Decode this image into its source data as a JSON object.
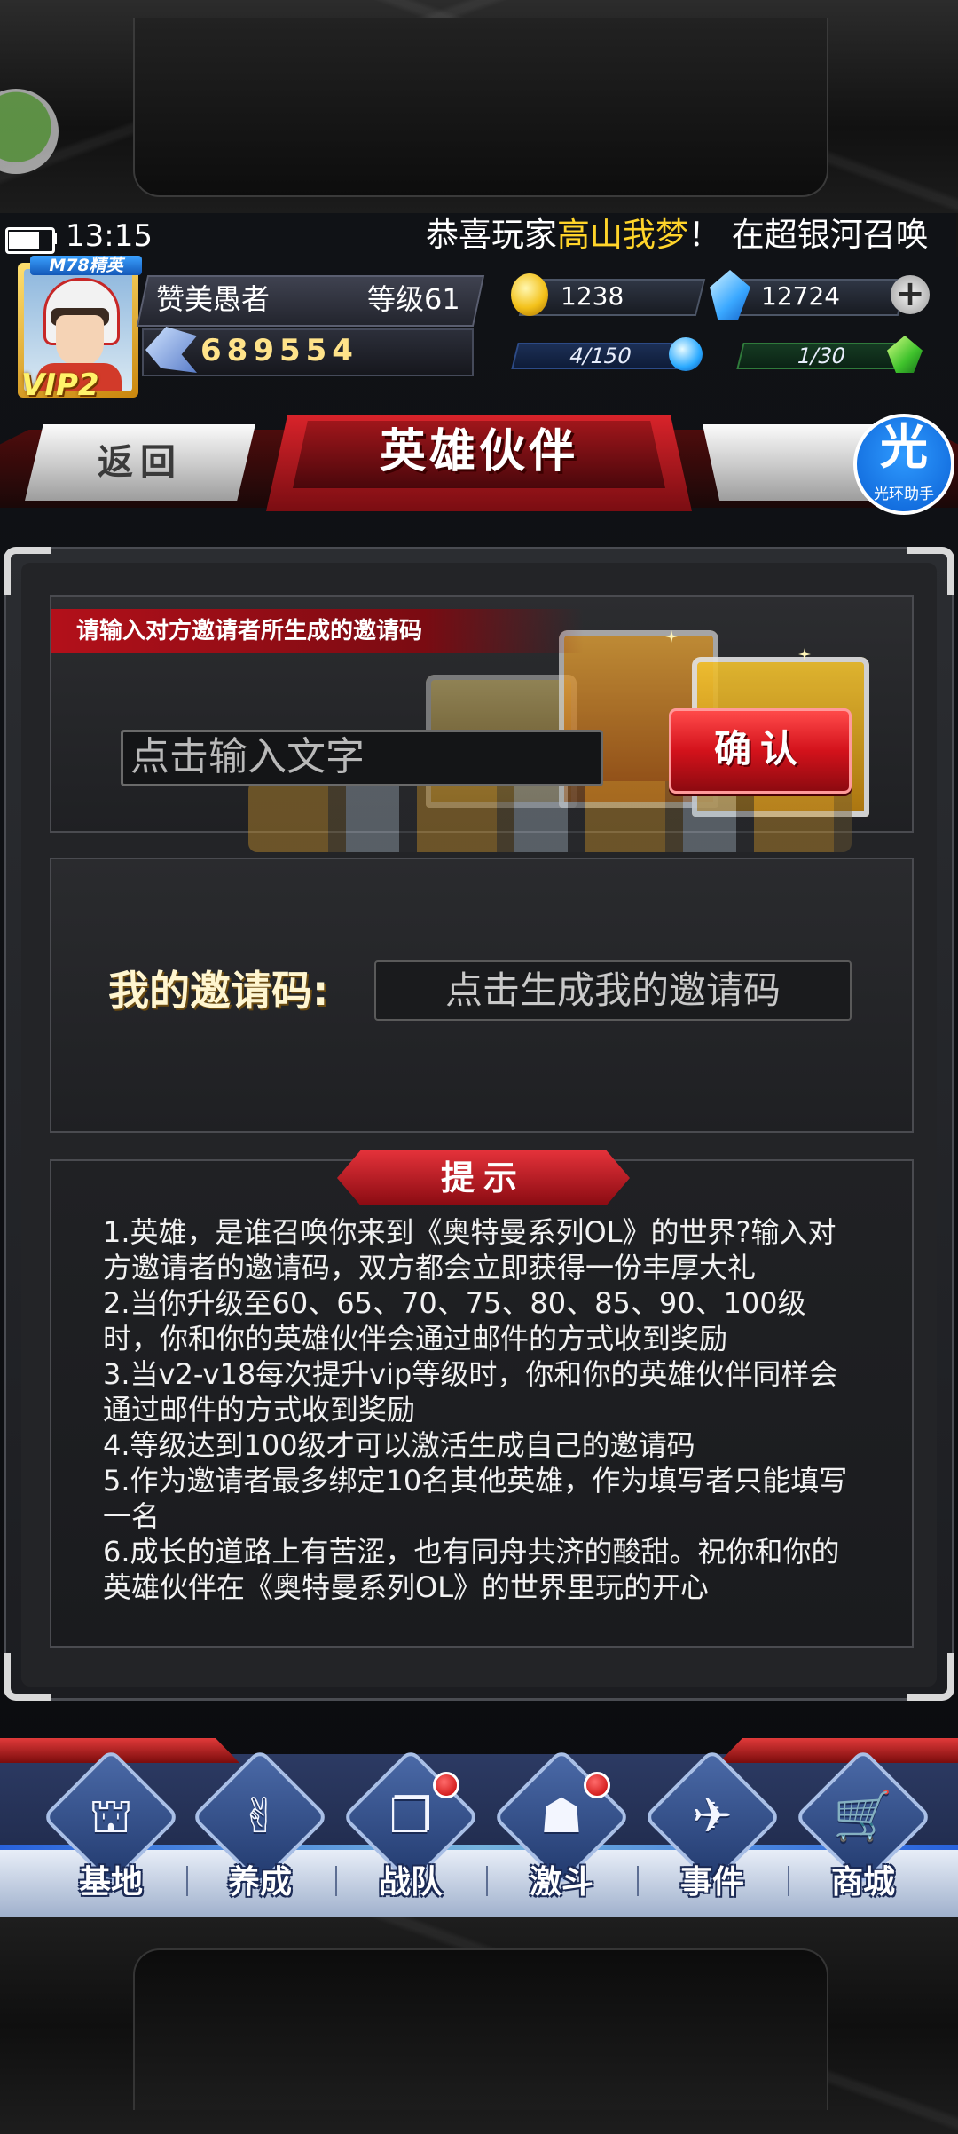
{
  "status": {
    "time": "13:15",
    "ticker_prefix": "恭喜玩家",
    "ticker_highlight": "高山我梦",
    "ticker_suffix": "！ 在超银河召唤"
  },
  "player": {
    "rank_badge": "M78精英",
    "vip": "VIP2",
    "name": "赞美愚者",
    "level": "等级61",
    "power": "689554"
  },
  "resources": {
    "gold": "1238",
    "gems": "12724",
    "stamina": "4/150",
    "energy": "1/30",
    "plus_glyph": "+"
  },
  "header": {
    "back_label": "返回",
    "title": "英雄伙伴",
    "helper_glyph": "光",
    "helper_label": "光环助手"
  },
  "invite": {
    "instruction": "请输入对方邀请者所生成的邀请码",
    "input_placeholder": "点击输入文字",
    "confirm_label": "确认"
  },
  "my_code": {
    "label": "我的邀请码:",
    "button_text": "点击生成我的邀请码"
  },
  "tips": {
    "title": "提示",
    "items": [
      "1.英雄，是谁召唤你来到《奥特曼系列OL》的世界?输入对方邀请者的邀请码，双方都会立即获得一份丰厚大礼",
      "2.当你升级至60、65、70、75、80、85、90、100级时，你和你的英雄伙伴会通过邮件的方式收到奖励",
      "3.当v2-v18每次提升vip等级时，你和你的英雄伙伴同样会通过邮件的方式收到奖励",
      "4.等级达到100级才可以激活生成自己的邀请码",
      "5.作为邀请者最多绑定10名其他英雄，作为填写者只能填写一名",
      "6.成长的道路上有苦涩，也有同舟共济的酸甜。祝你和你的英雄伙伴在《奥特曼系列OL》的世界里玩的开心"
    ]
  },
  "nav": {
    "items": [
      {
        "label": "基地",
        "icon": "base-icon",
        "glyph": "⛫",
        "badge": false
      },
      {
        "label": "养成",
        "icon": "training-icon",
        "glyph": "✌",
        "badge": false
      },
      {
        "label": "战队",
        "icon": "team-cards-icon",
        "glyph": "❐",
        "badge": true
      },
      {
        "label": "激斗",
        "icon": "battle-helmet-icon",
        "glyph": "☗",
        "badge": true
      },
      {
        "label": "事件",
        "icon": "jet-icon",
        "glyph": "✈",
        "badge": false
      },
      {
        "label": "商城",
        "icon": "shopping-cart-icon",
        "glyph": "🛒",
        "badge": false
      }
    ]
  },
  "colors": {
    "highlight": "#ffd42a",
    "title_red": "#d8232a",
    "nav_blue": "#223a6e"
  }
}
